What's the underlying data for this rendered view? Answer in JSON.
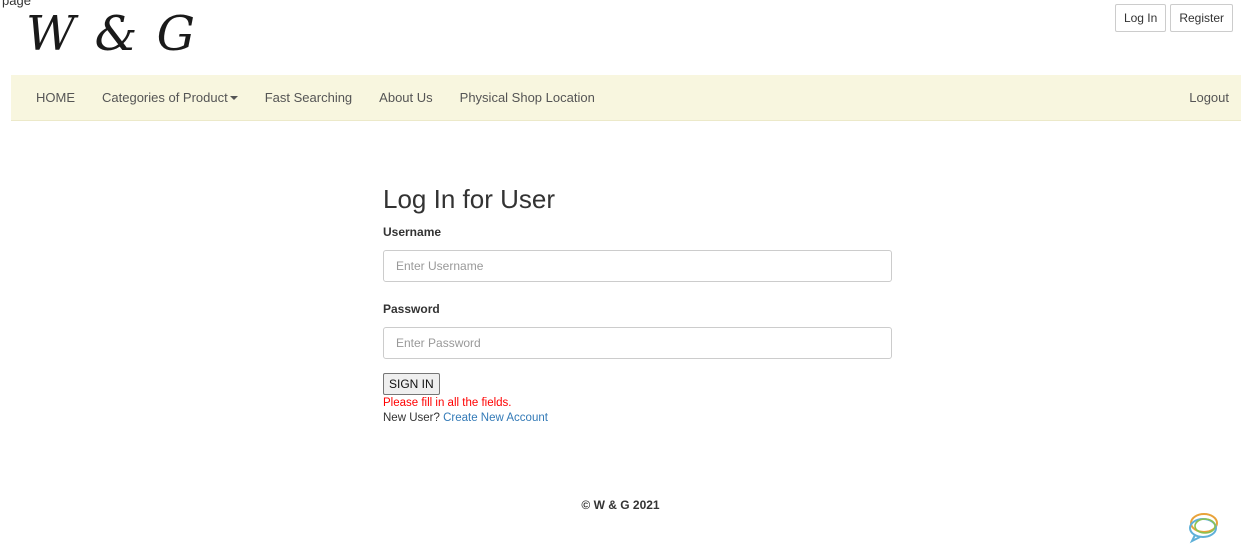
{
  "page": {
    "caption": "page"
  },
  "brand": {
    "logo_text": "W & G"
  },
  "auth": {
    "login_label": "Log In",
    "register_label": "Register"
  },
  "nav": {
    "items": [
      {
        "label": "HOME"
      },
      {
        "label": "Categories of Product"
      },
      {
        "label": "Fast Searching"
      },
      {
        "label": "About Us"
      },
      {
        "label": "Physical Shop Location"
      }
    ],
    "logout_label": "Logout"
  },
  "login": {
    "title": "Log In for User",
    "username_label": "Username",
    "username_placeholder": "Enter Username",
    "username_value": "",
    "password_label": "Password",
    "password_placeholder": "Enter Password",
    "password_value": "",
    "submit_label": "SIGN IN",
    "error_text": "Please fill in all the fields.",
    "new_user_text": "New User?",
    "create_account_label": "Create New Account"
  },
  "footer": {
    "copyright": "© W & G 2021"
  },
  "icons": {
    "chat_widget": "chat-bubbles-icon"
  },
  "colors": {
    "navbar_bg": "#f8f6df",
    "link": "#337ab7",
    "error": "#ff0000"
  }
}
